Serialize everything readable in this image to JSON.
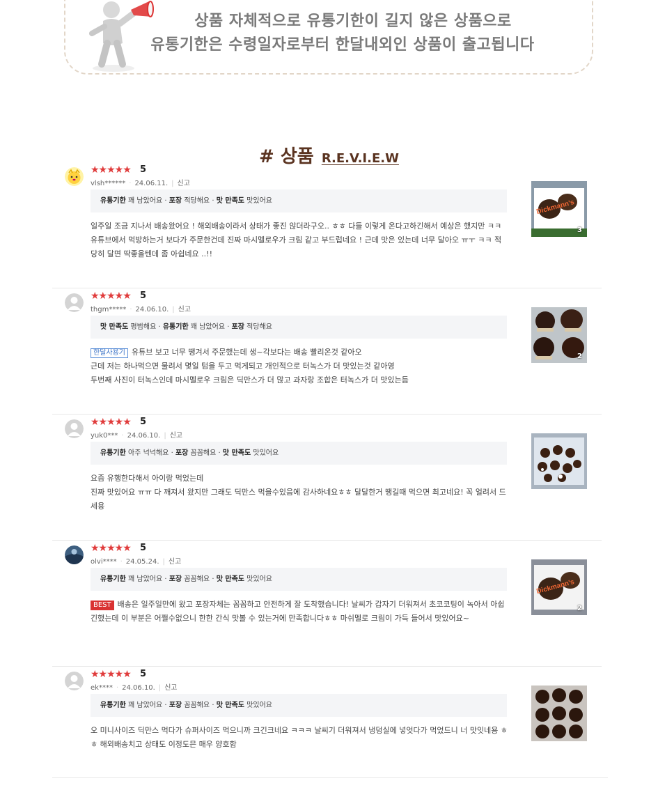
{
  "notice": {
    "line1": "상품 자체적으로 유통기한이 길지 않은 상품으로",
    "line2": "유통기한은 수령일자로부터 한달내외인 상품이 출고됩니다"
  },
  "review_header": {
    "hash": "# 상품",
    "sub": "R.E.V.I.E.W"
  },
  "report_label": "신고",
  "star_icons": "★★★★★",
  "colors": {
    "accent": "#5a3320",
    "stars": "#e03b3b",
    "best_badge": "#d93232",
    "month_badge": "#3d74c7"
  },
  "reviews": [
    {
      "score": "5",
      "user": "vlsh******",
      "date": "24.06.11.",
      "avatar_icon": "character-avatar-icon",
      "tags": [
        {
          "k": "유통기한",
          "v": "꽤 남았어요"
        },
        {
          "k": "포장",
          "v": "적당해요"
        },
        {
          "k": "맛 만족도",
          "v": "맛있어요"
        }
      ],
      "badge": "",
      "text": "일주일 조금 지나서 배송왔어요 ! 해외배송이라서 상태가 좋진 않더라구오.. ㅎㅎ 다들 이렇게 온다고하긴해서 예상은 했지만 ㅋㅋ 유튜브에서 먹방하는거 보다가 주문한건데 진짜 마시멜로우가 크림 같고 부드럽네요 ! 근데 맛은 있는데 너무 달아오 ㅠㅜ ㅋㅋ 적당히 달면 딱좋을텐데 좀 아쉽네요 ..!!",
      "photo_count": "3"
    },
    {
      "score": "5",
      "user": "thgm*****",
      "date": "24.06.10.",
      "avatar_icon": "default-avatar-icon",
      "tags": [
        {
          "k": "맛 만족도",
          "v": "평범해요"
        },
        {
          "k": "유통기한",
          "v": "꽤 남았어요"
        },
        {
          "k": "포장",
          "v": "적당해요"
        }
      ],
      "badge": "한달사용기",
      "text": "유튜브 보고 너무 땡겨서 주문했는데 생~각보다는 배송 빨리온것 같아오\n근데 저는 하나먹으면 물려서 몇일 텀을 두고 먹게되고 개인적으로 터녹스가 더 맛있는것 같아영\n두번째 사진이 터녹스인데 마시멜로우 크림은 딕만스가 더 많고 과자랑 조합은 터녹스가 더 맛있는듬",
      "photo_count": "2"
    },
    {
      "score": "5",
      "user": "yuk0***",
      "date": "24.06.10.",
      "avatar_icon": "default-avatar-icon",
      "tags": [
        {
          "k": "유통기한",
          "v": "아주 넉넉해요"
        },
        {
          "k": "포장",
          "v": "꼼꼼해요"
        },
        {
          "k": "맛 만족도",
          "v": "맛있어요"
        }
      ],
      "badge": "",
      "text": "요즘 유행한다해서 아이랑 먹었는데\n진짜 맛있어요 ㅠㅠ 다 깨져서 왔지만 그래도 딕만스 먹을수있음에 감사하네요ㅎㅎ 달달한거 땡길때 먹으면 최고네요! 꼭 얼려서 드세용",
      "photo_count": ""
    },
    {
      "score": "5",
      "user": "olvi****",
      "date": "24.05.24.",
      "avatar_icon": "photo-avatar-icon",
      "tags": [
        {
          "k": "유통기한",
          "v": "꽤 남았어요"
        },
        {
          "k": "포장",
          "v": "꼼꼼해요"
        },
        {
          "k": "맛 만족도",
          "v": "맛있어요"
        }
      ],
      "badge": "BEST",
      "text": "배송은 일주일만에 왔고 포장자체는 꼼꼼하고 안전하게 잘 도착했습니다! 날씨가 갑자기 더워져서 초코코팅이 녹아서 아쉽긴했는데 이 부분은 어쩔수없으니 한한 간식 맛볼 수 있는거에 만족합니다ㅎㅎ 마쉬멜로 크림이 가득 들어서 맛있어요~",
      "photo_count": "2"
    },
    {
      "score": "5",
      "user": "ek****",
      "date": "24.06.10.",
      "avatar_icon": "default-avatar-icon",
      "tags": [
        {
          "k": "유통기한",
          "v": "꽤 남았어요"
        },
        {
          "k": "포장",
          "v": "꼼꼼해요"
        },
        {
          "k": "맛 만족도",
          "v": "맛있어요"
        }
      ],
      "badge": "",
      "text": "오 미니사이즈 딕만스 먹다가 슈퍼사이즈 먹으니까 크긴크네요 ㅋㅋㅋ 날씨기 더워져서 냉덩실에 넣엇다가 먹었드니 너 맛잇네용 ㅎㅎ 해외배송치고 상태도 이정도믄 매우 양호함",
      "photo_count": ""
    }
  ]
}
